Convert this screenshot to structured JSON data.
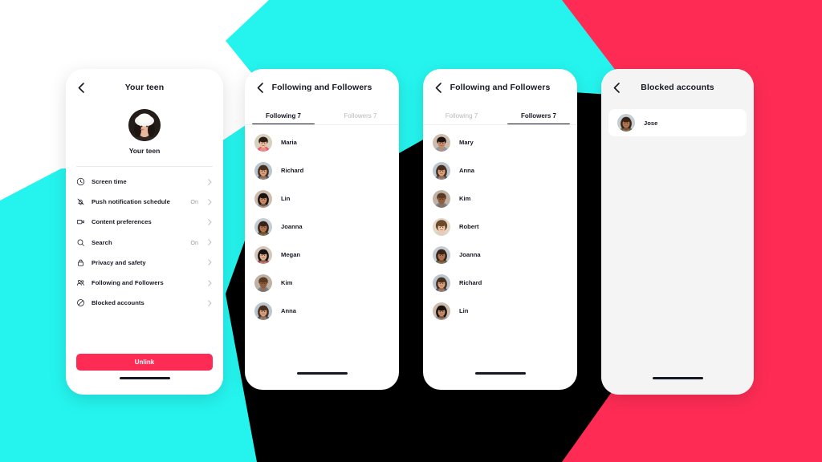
{
  "palette": {
    "cyan": "#25F4EE",
    "red": "#FE2C55",
    "black": "#000000",
    "white": "#FFFFFF",
    "grey_screen": "#F4F4F4",
    "text": "#161823",
    "muted": "#B8B8BD"
  },
  "icons": {
    "back": "chevron-left-icon",
    "chevron": "chevron-right-icon"
  },
  "screens": {
    "teen": {
      "title": "Your teen",
      "profile_name": "Your teen",
      "settings": [
        {
          "icon": "clock-icon",
          "label": "Screen time",
          "value": ""
        },
        {
          "icon": "bell-off-icon",
          "label": "Push notification schedule",
          "value": "On"
        },
        {
          "icon": "video-icon",
          "label": "Content preferences",
          "value": ""
        },
        {
          "icon": "search-icon",
          "label": "Search",
          "value": "On"
        },
        {
          "icon": "lock-icon",
          "label": "Privacy and safety",
          "value": ""
        },
        {
          "icon": "people-icon",
          "label": "Following and Followers",
          "value": ""
        },
        {
          "icon": "block-icon",
          "label": "Blocked accounts",
          "value": ""
        }
      ],
      "unlink_label": "Unlink"
    },
    "following": {
      "title": "Following and Followers",
      "tabs": [
        {
          "label": "Following 7",
          "active": true
        },
        {
          "label": "Followers 7",
          "active": false
        }
      ],
      "users": [
        {
          "name": "Maria"
        },
        {
          "name": "Richard"
        },
        {
          "name": "Lin"
        },
        {
          "name": "Joanna"
        },
        {
          "name": "Megan"
        },
        {
          "name": "Kim"
        },
        {
          "name": "Anna"
        }
      ]
    },
    "followers": {
      "title": "Following and Followers",
      "tabs": [
        {
          "label": "Following 7",
          "active": false
        },
        {
          "label": "Followers 7",
          "active": true
        }
      ],
      "users": [
        {
          "name": "Mary"
        },
        {
          "name": "Anna"
        },
        {
          "name": "Kim"
        },
        {
          "name": "Robert"
        },
        {
          "name": "Joanna"
        },
        {
          "name": "Richard"
        },
        {
          "name": "Lin"
        }
      ]
    },
    "blocked": {
      "title": "Blocked accounts",
      "users": [
        {
          "name": "Jose"
        }
      ]
    }
  }
}
